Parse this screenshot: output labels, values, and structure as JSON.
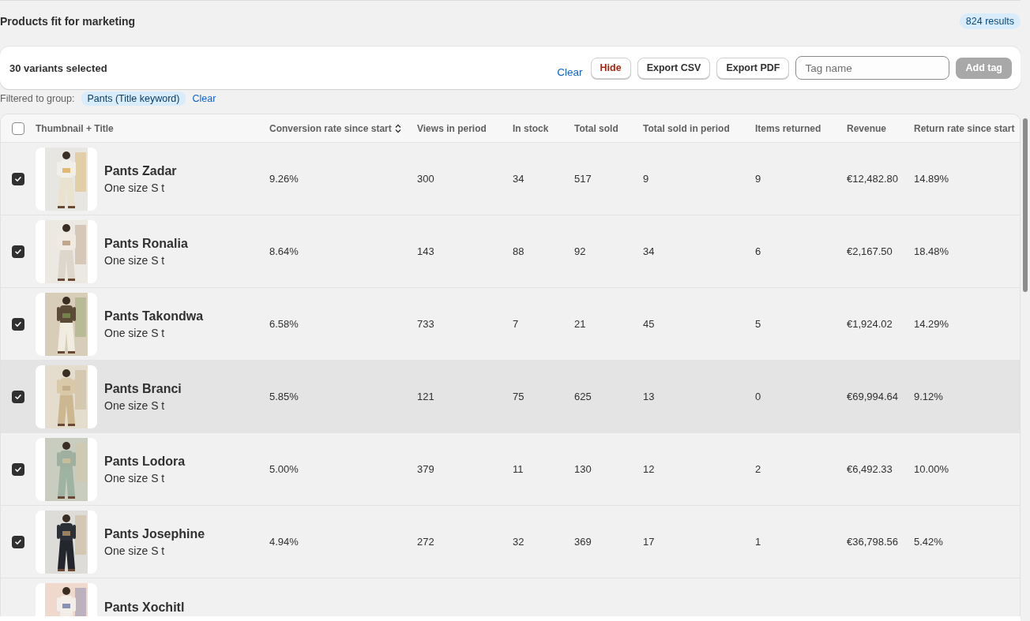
{
  "header": {
    "title": "Products fit for marketing",
    "results": "824 results"
  },
  "selection_bar": {
    "count_label": "30 variants selected",
    "actions": [
      {
        "label": "Clear",
        "kind": "link"
      },
      {
        "label": "Hide",
        "kind": "critical"
      },
      {
        "label": "Export CSV",
        "kind": "default"
      },
      {
        "label": "Export PDF",
        "kind": "default"
      }
    ],
    "tag_field": {
      "placeholder": "Tag name"
    },
    "add_button": {
      "label": "Add tag",
      "disabled": true
    }
  },
  "filter": {
    "label": "Filtered to group:",
    "chip": "Pants (Title keyword)",
    "clear": "Clear"
  },
  "table": {
    "select_all_checked": false,
    "columns": [
      {
        "label": "Thumbnail + Title",
        "sortable": false
      },
      {
        "label": "Conversion rate since start",
        "sortable": true
      },
      {
        "label": "Views in period",
        "sortable": false
      },
      {
        "label": "In stock",
        "sortable": false
      },
      {
        "label": "Total sold",
        "sortable": false
      },
      {
        "label": "Total sold in period",
        "sortable": false
      },
      {
        "label": "Items returned",
        "sortable": false
      },
      {
        "label": "Revenue",
        "sortable": false
      },
      {
        "label": "Return rate since start",
        "sortable": false
      }
    ],
    "rows": [
      {
        "title": "Pants Zadar",
        "variant": "One size S t",
        "checked": true,
        "highlighted": false,
        "cells": [
          "9.26%",
          "300",
          "34",
          "517",
          "9",
          "9",
          "€12,482.80",
          "14.89%"
        ]
      },
      {
        "title": "Pants Ronalia",
        "variant": "One size S t",
        "checked": true,
        "highlighted": false,
        "cells": [
          "8.64%",
          "143",
          "88",
          "92",
          "34",
          "6",
          "€2,167.50",
          "18.48%"
        ]
      },
      {
        "title": "Pants Takondwa",
        "variant": "One size S t",
        "checked": true,
        "highlighted": false,
        "cells": [
          "6.58%",
          "733",
          "7",
          "21",
          "45",
          "5",
          "€1,924.02",
          "14.29%"
        ]
      },
      {
        "title": "Pants Branci",
        "variant": "One size S t",
        "checked": true,
        "highlighted": true,
        "cells": [
          "5.85%",
          "121",
          "75",
          "625",
          "13",
          "0",
          "€69,994.64",
          "9.12%"
        ]
      },
      {
        "title": "Pants Lodora",
        "variant": "One size S t",
        "checked": true,
        "highlighted": false,
        "cells": [
          "5.00%",
          "379",
          "11",
          "130",
          "12",
          "2",
          "€6,492.33",
          "10.00%"
        ]
      },
      {
        "title": "Pants Josephine",
        "variant": "One size S t",
        "checked": true,
        "highlighted": false,
        "cells": [
          "4.94%",
          "272",
          "32",
          "369",
          "17",
          "1",
          "€36,798.56",
          "5.42%"
        ]
      },
      {
        "title": "Pants Xochitl"
      }
    ]
  }
}
